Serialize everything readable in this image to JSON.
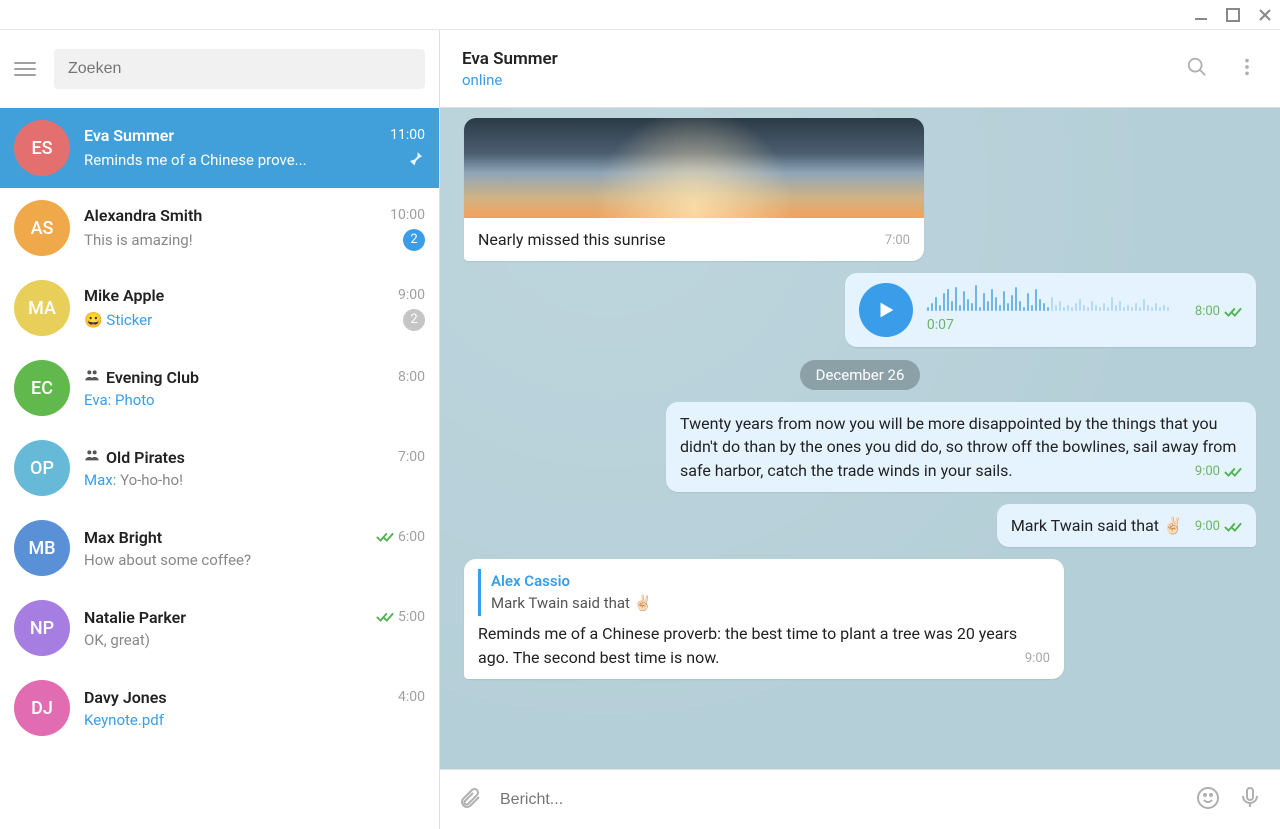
{
  "search": {
    "placeholder": "Zoeken"
  },
  "chats": [
    {
      "id": 0,
      "name": "Eva Summer",
      "time": "11:00",
      "preview": "Reminds me of a Chinese prove...",
      "initials": "ES",
      "color": "#e36f6f",
      "active": true,
      "pinned": true
    },
    {
      "id": 1,
      "name": "Alexandra Smith",
      "time": "10:00",
      "preview": "This is amazing!",
      "initials": "AS",
      "color": "#f0a94a",
      "badge": "2",
      "badgeColor": "blue"
    },
    {
      "id": 2,
      "name": "Mike Apple",
      "time": "9:00",
      "preview_prefix": "😀 ",
      "preview_link": "Sticker",
      "initials": "MA",
      "color": "#e8cf5a",
      "badge": "2",
      "badgeColor": "gray"
    },
    {
      "id": 3,
      "name": "Evening Club",
      "time": "8:00",
      "preview_link_prefix": "Eva: ",
      "preview_link": "Photo",
      "initials": "EC",
      "color": "#61b84c",
      "group": true
    },
    {
      "id": 4,
      "name": "Old Pirates",
      "time": "7:00",
      "preview_link_prefix": "Max: ",
      "preview_suffix": "Yo-ho-ho!",
      "initials": "OP",
      "color": "#67b9d8",
      "group": true
    },
    {
      "id": 5,
      "name": "Max Bright",
      "time": "6:00",
      "preview": "How about some coffee?",
      "initials": "MB",
      "color": "#5a90d6",
      "checks": true
    },
    {
      "id": 6,
      "name": "Natalie Parker",
      "time": "5:00",
      "preview": "OK, great)",
      "initials": "NP",
      "color": "#a67de0",
      "checks": true
    },
    {
      "id": 7,
      "name": "Davy Jones",
      "time": "4:00",
      "preview_link": "Keynote.pdf",
      "initials": "DJ",
      "color": "#e26cb1"
    }
  ],
  "header": {
    "title": "Eva Summer",
    "status": "online"
  },
  "messages": {
    "photo_caption": "Nearly missed this sunrise",
    "photo_time": "7:00",
    "voice_duration": "0:07",
    "voice_time": "8:00",
    "date_separator": "December 26",
    "quote_text": "Twenty years from now you will be more disappointed by the things that you didn't do than by the ones you did do, so throw off the bowlines, sail away from safe harbor, catch the trade winds in your sails.",
    "quote_time": "9:00",
    "twain_text": "Mark Twain said that ",
    "twain_emoji": "✌🏻",
    "twain_time": "9:00",
    "reply_name": "Alex Cassio",
    "reply_quoted": "Mark Twain said that ✌🏻",
    "reply_text": "Reminds me of a Chinese proverb: the best time to plant a tree was 20 years ago. The second best time is now.",
    "reply_time": "9:00"
  },
  "input": {
    "placeholder": "Bericht..."
  }
}
